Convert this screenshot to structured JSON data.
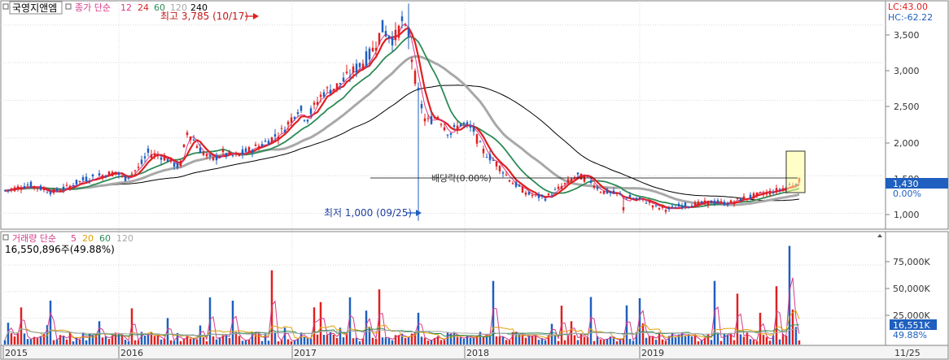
{
  "stock_name": "국영지앤엠",
  "price_legend": {
    "label": "종가 단순",
    "periods": [
      {
        "value": "12",
        "color": "#d63a8a"
      },
      {
        "value": "24",
        "color": "#e02020"
      },
      {
        "value": "60",
        "color": "#2e8b57"
      },
      {
        "value": "120",
        "color": "#a8a8a8"
      },
      {
        "value": "240",
        "color": "#000000"
      }
    ]
  },
  "volume_legend": {
    "label": "거래량 단순",
    "periods": [
      {
        "value": "5",
        "color": "#d63a8a"
      },
      {
        "value": "20",
        "color": "#e0a000"
      },
      {
        "value": "60",
        "color": "#2e8b57"
      },
      {
        "value": "120",
        "color": "#a8a8a8"
      }
    ],
    "current_volume": "16,550,896주(49.88%)"
  },
  "corner": {
    "lc": "LC:43.00",
    "hc": "HC:-62.22"
  },
  "annotations": {
    "high": "최고 3,785 (10/17)",
    "low": "최저 1,000 (09/25)",
    "dividend": "배당락(0.00%)"
  },
  "price_badge": {
    "value": "1,430",
    "pct": "0.00%"
  },
  "volume_badge": {
    "value": "16,551K",
    "pct": "49.88%"
  },
  "colors": {
    "up": "#e02020",
    "down": "#1f5fbf",
    "axis_text": "#333333",
    "grid": "#cccccc"
  },
  "chart_data": [
    {
      "type": "candlestick",
      "title": "국영지앤엠",
      "x_labels": [
        "2015",
        "2016",
        "2017",
        "2018",
        "2019",
        "11/25"
      ],
      "y_ticks": [
        "3,500",
        "3,000",
        "2,500",
        "2,000",
        "1,500",
        "1,000"
      ],
      "ylim": [
        800,
        3800
      ],
      "grid": true,
      "high": {
        "value": 3785,
        "date": "10/17"
      },
      "low": {
        "value": 1000,
        "date": "09/25"
      },
      "last_close": 1430,
      "close_path": [
        {
          "t": 0.0,
          "v": 1300
        },
        {
          "t": 0.03,
          "v": 1380
        },
        {
          "t": 0.06,
          "v": 1280
        },
        {
          "t": 0.08,
          "v": 1350
        },
        {
          "t": 0.1,
          "v": 1450
        },
        {
          "t": 0.12,
          "v": 1500
        },
        {
          "t": 0.14,
          "v": 1550
        },
        {
          "t": 0.15,
          "v": 1450
        },
        {
          "t": 0.17,
          "v": 1620
        },
        {
          "t": 0.18,
          "v": 1800
        },
        {
          "t": 0.2,
          "v": 1750
        },
        {
          "t": 0.22,
          "v": 1600
        },
        {
          "t": 0.23,
          "v": 2100
        },
        {
          "t": 0.245,
          "v": 1850
        },
        {
          "t": 0.26,
          "v": 1700
        },
        {
          "t": 0.275,
          "v": 1800
        },
        {
          "t": 0.29,
          "v": 1750
        },
        {
          "t": 0.31,
          "v": 1850
        },
        {
          "t": 0.33,
          "v": 1950
        },
        {
          "t": 0.35,
          "v": 2100
        },
        {
          "t": 0.37,
          "v": 2400
        },
        {
          "t": 0.38,
          "v": 2250
        },
        {
          "t": 0.4,
          "v": 2600
        },
        {
          "t": 0.42,
          "v": 2700
        },
        {
          "t": 0.44,
          "v": 2900
        },
        {
          "t": 0.46,
          "v": 3100
        },
        {
          "t": 0.475,
          "v": 3450
        },
        {
          "t": 0.49,
          "v": 3300
        },
        {
          "t": 0.5,
          "v": 3550
        },
        {
          "t": 0.51,
          "v": 3200
        },
        {
          "t": 0.52,
          "v": 2600
        },
        {
          "t": 0.53,
          "v": 2200
        },
        {
          "t": 0.545,
          "v": 2300
        },
        {
          "t": 0.56,
          "v": 2050
        },
        {
          "t": 0.575,
          "v": 2200
        },
        {
          "t": 0.59,
          "v": 2100
        },
        {
          "t": 0.6,
          "v": 1850
        },
        {
          "t": 0.62,
          "v": 1650
        },
        {
          "t": 0.64,
          "v": 1400
        },
        {
          "t": 0.66,
          "v": 1250
        },
        {
          "t": 0.68,
          "v": 1200
        },
        {
          "t": 0.7,
          "v": 1350
        },
        {
          "t": 0.72,
          "v": 1500
        },
        {
          "t": 0.735,
          "v": 1450
        },
        {
          "t": 0.75,
          "v": 1300
        },
        {
          "t": 0.77,
          "v": 1250
        },
        {
          "t": 0.79,
          "v": 1200
        },
        {
          "t": 0.81,
          "v": 1150
        },
        {
          "t": 0.82,
          "v": 1080
        },
        {
          "t": 0.835,
          "v": 1050
        },
        {
          "t": 0.85,
          "v": 1100
        },
        {
          "t": 0.87,
          "v": 1120
        },
        {
          "t": 0.89,
          "v": 1150
        },
        {
          "t": 0.91,
          "v": 1130
        },
        {
          "t": 0.93,
          "v": 1200
        },
        {
          "t": 0.95,
          "v": 1250
        },
        {
          "t": 0.97,
          "v": 1300
        },
        {
          "t": 0.985,
          "v": 1350
        },
        {
          "t": 1.0,
          "v": 1430
        }
      ]
    },
    {
      "type": "bar",
      "title": "거래량",
      "y_ticks": [
        "75,000K",
        "50,000K",
        "25,000K"
      ],
      "ylim": [
        0,
        95000
      ],
      "unit": "K",
      "current": 16551
    }
  ]
}
